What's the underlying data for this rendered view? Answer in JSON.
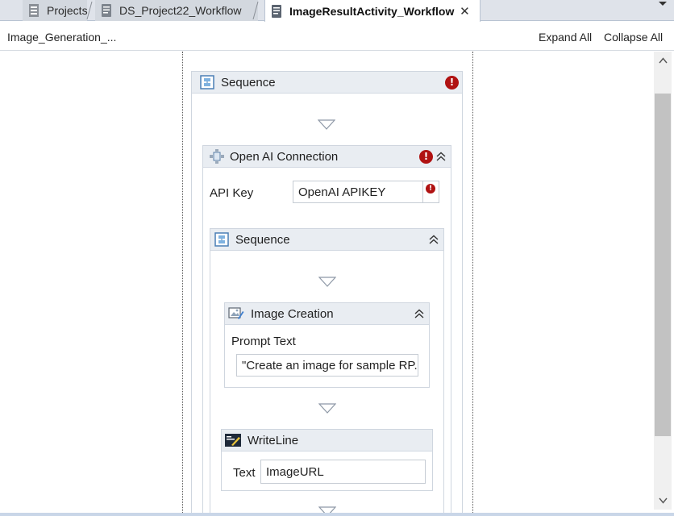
{
  "tabs": [
    {
      "label": "Projects",
      "icon": "projects-icon",
      "active": false
    },
    {
      "label": "DS_Project22_Workflow",
      "icon": "workflow-file-icon",
      "active": false
    },
    {
      "label": "ImageResultActivity_Workflow",
      "icon": "workflow-file-icon",
      "active": true,
      "close": "✕"
    }
  ],
  "breadcrumb": {
    "label": "Image_Generation_...",
    "expand_all": "Expand All",
    "collapse_all": "Collapse All"
  },
  "workflow": {
    "outer_sequence": {
      "title": "Sequence",
      "has_error": true,
      "error_glyph": "!"
    },
    "openai_connection": {
      "title": "Open AI Connection",
      "has_error": true,
      "error_glyph": "!",
      "api_key_label": "API Key",
      "api_key_value": "OpenAI APIKEY",
      "api_key_error": true
    },
    "inner_sequence": {
      "title": "Sequence"
    },
    "image_creation": {
      "title": "Image Creation",
      "prompt_label": "Prompt Text",
      "prompt_value": "\"Create an image for sample RP."
    },
    "writeline": {
      "title": "WriteLine",
      "text_label": "Text",
      "text_value": "ImageURL"
    }
  },
  "colors": {
    "error_red": "#b01212",
    "activity_header": "#e9edf2",
    "tab_active": "#ffffff",
    "tab_strip": "#dfe3ea"
  }
}
